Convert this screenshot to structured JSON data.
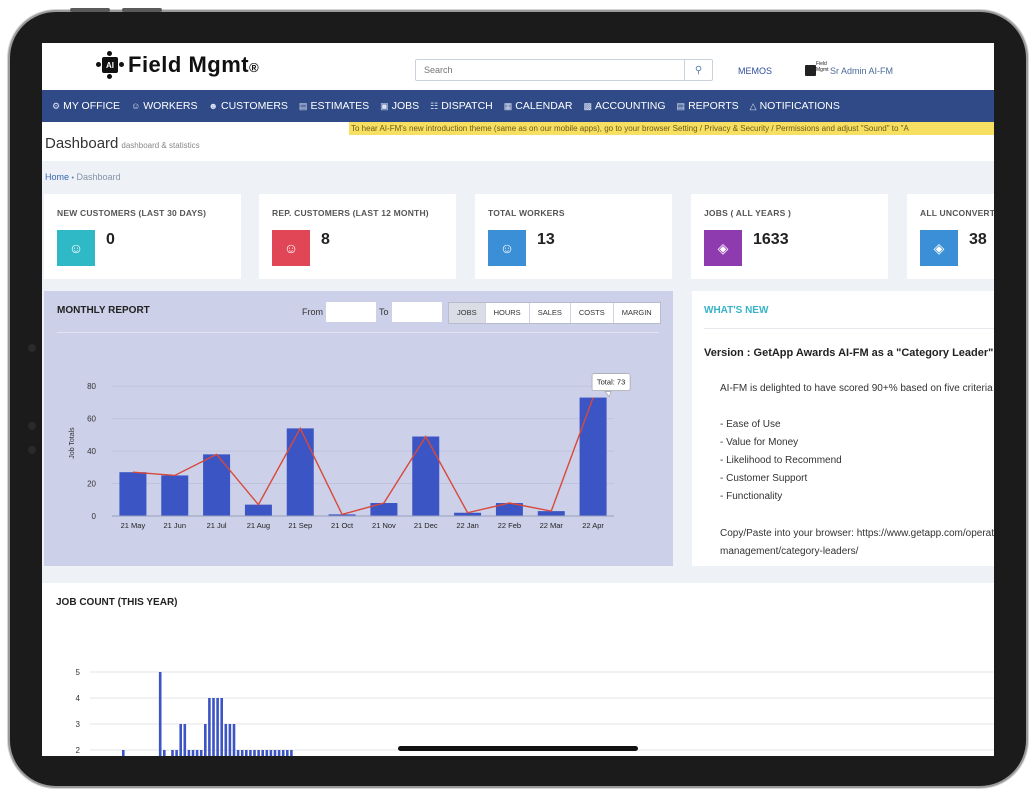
{
  "app": {
    "logo_text": "Field Mgmt",
    "logo_reg": "®",
    "logo_badge": "AI"
  },
  "search": {
    "placeholder": "Search"
  },
  "header": {
    "memos": "MEMOS",
    "user": "Sr Admin AI-FM",
    "user_logo_text": "Field Mgmt"
  },
  "nav": [
    {
      "label": "MY OFFICE",
      "icon": "gear-icon"
    },
    {
      "label": "WORKERS",
      "icon": "user-icon"
    },
    {
      "label": "CUSTOMERS",
      "icon": "users-icon"
    },
    {
      "label": "ESTIMATES",
      "icon": "document-icon"
    },
    {
      "label": "JOBS",
      "icon": "briefcase-icon"
    },
    {
      "label": "DISPATCH",
      "icon": "clipboard-icon"
    },
    {
      "label": "CALENDAR",
      "icon": "calendar-icon"
    },
    {
      "label": "ACCOUNTING",
      "icon": "accounting-icon"
    },
    {
      "label": "REPORTS",
      "icon": "report-icon"
    },
    {
      "label": "NOTIFICATIONS",
      "icon": "bell-icon"
    }
  ],
  "notice": "To hear AI-FM's new introduction theme (same as on our mobile apps), go to your browser Setting / Privacy & Security / Permissions and adjust \"Sound\" to \"A",
  "page": {
    "title": "Dashboard",
    "subtitle": "dashboard & statistics"
  },
  "breadcrumb": {
    "home": "Home",
    "sep": "•",
    "current": "Dashboard"
  },
  "cards": [
    {
      "label": "NEW CUSTOMERS (LAST 30 DAYS)",
      "value": "0",
      "color": "#2fb8c6",
      "icon": "user-icon"
    },
    {
      "label": "REP. CUSTOMERS (LAST 12 MONTH)",
      "value": "8",
      "color": "#e04656",
      "icon": "user-icon"
    },
    {
      "label": "TOTAL WORKERS",
      "value": "13",
      "color": "#3b8fd6",
      "icon": "user-icon"
    },
    {
      "label": "JOBS ( ALL YEARS )",
      "value": "1633",
      "color": "#8e3bb0",
      "icon": "layers-icon"
    },
    {
      "label": "ALL UNCONVERTED ESTIMATES",
      "value": "38",
      "color": "#3b8fd6",
      "icon": "layers-icon"
    }
  ],
  "monthly": {
    "title": "MONTHLY REPORT",
    "from_label": "From",
    "to_label": "To",
    "from_value": "",
    "to_value": "",
    "tabs": [
      "JOBS",
      "HOURS",
      "SALES",
      "COSTS",
      "MARGIN"
    ],
    "active_tab": "JOBS",
    "tooltip": "Total: 73"
  },
  "news": {
    "title": "WHAT'S NEW",
    "version": "Version : GetApp Awards AI-FM as a \"Category Leader\"",
    "intro": "AI-FM is delighted to have scored 90+% based on five criteria",
    "bullets": [
      "- Ease of Use",
      "- Value for Money",
      "- Likelihood to Recommend",
      "- Customer Support",
      "- Functionality"
    ],
    "copy_line1": "Copy/Paste into your browser: https://www.getapp.com/operations-",
    "copy_line2": "management/category-leaders/"
  },
  "jobcount": {
    "title": "JOB COUNT (THIS YEAR)"
  },
  "chart_data": [
    {
      "type": "bar",
      "title": "MONTHLY REPORT",
      "xlabel": "",
      "ylabel": "Job Totals",
      "categories": [
        "21 May",
        "21 Jun",
        "21 Jul",
        "21 Aug",
        "21 Sep",
        "21 Oct",
        "21 Nov",
        "21 Dec",
        "22 Jan",
        "22 Feb",
        "22 Mar",
        "22 Apr"
      ],
      "values": [
        27,
        25,
        38,
        7,
        54,
        1,
        8,
        49,
        2,
        8,
        3,
        73
      ],
      "line_overlay": true,
      "ylim": [
        0,
        90
      ],
      "yticks": [
        0,
        20,
        40,
        60,
        80
      ],
      "bar_color": "#3b55c4",
      "line_color": "#d8493b",
      "grid": true
    },
    {
      "type": "bar",
      "title": "JOB COUNT (THIS YEAR)",
      "yticks": [
        2,
        3,
        4,
        5
      ],
      "ylim": [
        1.6,
        5.4
      ],
      "values": [
        2,
        0,
        0,
        0,
        0,
        0,
        0,
        0,
        0,
        5,
        2,
        0,
        2,
        2,
        3,
        3,
        2,
        2,
        2,
        2,
        3,
        4,
        4,
        4,
        4,
        3,
        3,
        3,
        2,
        2,
        2,
        2,
        2,
        2,
        2,
        2,
        2,
        2,
        2,
        2,
        2,
        2
      ],
      "bar_color": "#3b55c4",
      "grid": true
    }
  ]
}
